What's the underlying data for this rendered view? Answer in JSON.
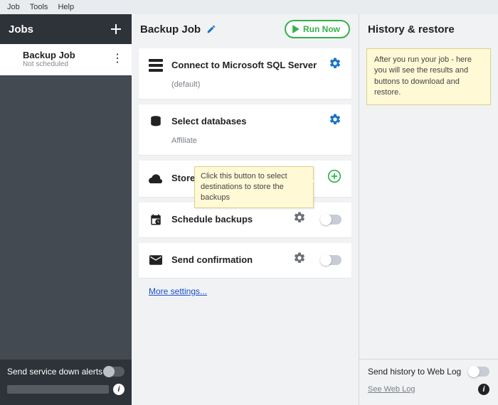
{
  "menu": {
    "job": "Job",
    "tools": "Tools",
    "help": "Help"
  },
  "left": {
    "title": "Jobs",
    "job": {
      "name": "Backup Job",
      "status": "Not scheduled"
    },
    "alerts_label": "Send service down alerts"
  },
  "mid": {
    "title": "Backup Job",
    "run": "Run Now",
    "steps": {
      "connect": {
        "label": "Connect to Microsoft SQL Server",
        "sub": "(default)"
      },
      "select": {
        "label": "Select databases",
        "sub": "Affiliate"
      },
      "store": {
        "label": "Store ba",
        "tooltip": "Click this button to select destinations to store the backups"
      },
      "schedule": {
        "label": "Schedule backups"
      },
      "confirm": {
        "label": "Send confirmation"
      }
    },
    "more": "More settings..."
  },
  "right": {
    "title": "History & restore",
    "info": "After you run your job - here you will see the results and buttons to download and restore.",
    "send_label": "Send history to Web Log",
    "see_log": "See Web Log"
  }
}
